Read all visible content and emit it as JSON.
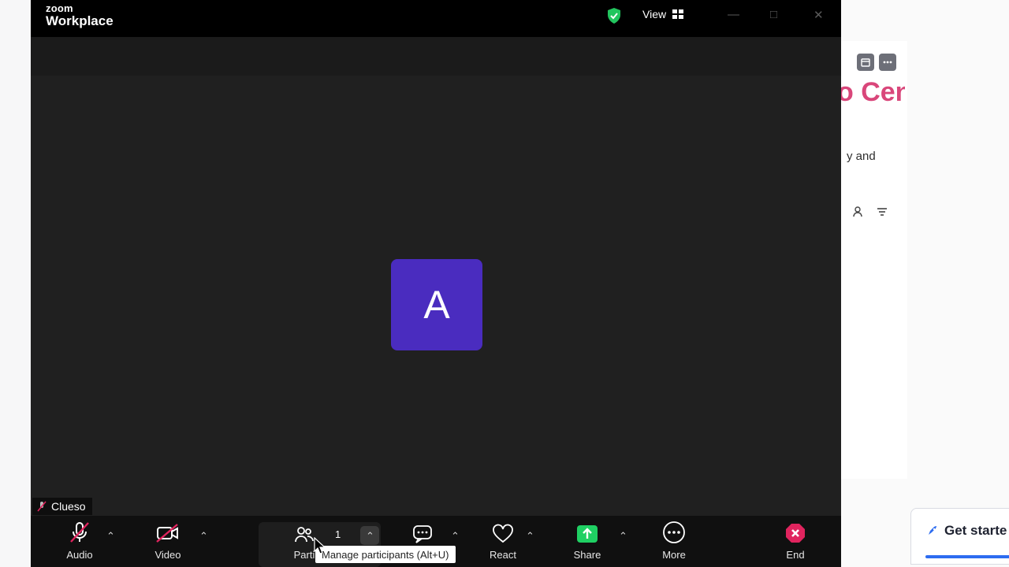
{
  "zoom": {
    "brand_small": "zoom",
    "brand_big": "Workplace",
    "view_label": "View",
    "participant_initial": "A",
    "participant_name": "Clueso",
    "participants_count": "1",
    "tooltip": "Manage participants (Alt+U)",
    "toolbar": {
      "audio": "Audio",
      "video": "Video",
      "participants": "Parti",
      "react": "React",
      "share": "Share",
      "more": "More",
      "end": "End"
    },
    "colors": {
      "avatar": "#4a2cbf",
      "share": "#1fd063",
      "end": "#e0245e",
      "shield": "#22c55e"
    }
  },
  "background_app": {
    "title_fragment": "o Cen",
    "text_fragment": "y and",
    "get_started": "Get starte"
  }
}
